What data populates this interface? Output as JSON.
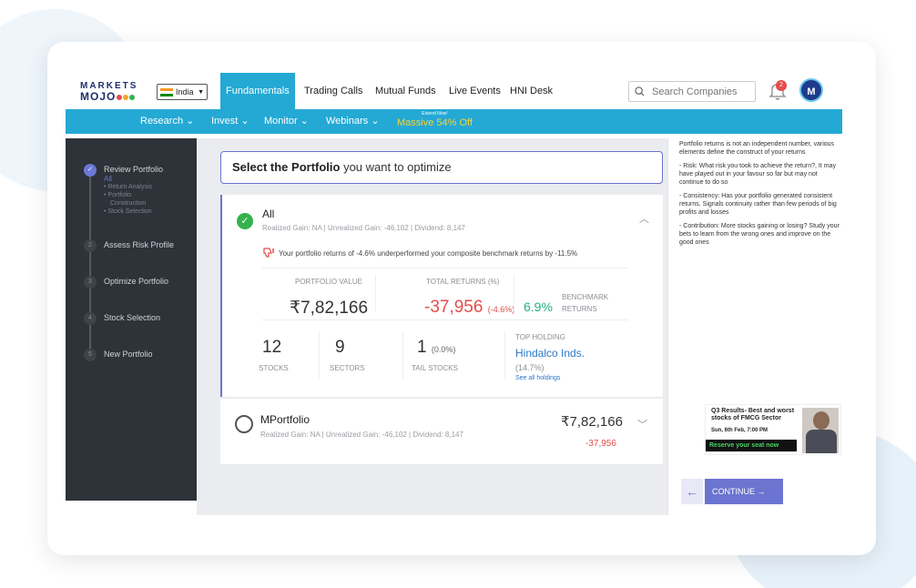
{
  "logo": {
    "line1": "MARKETS",
    "line2": "MOJO"
  },
  "country": {
    "label": "India"
  },
  "topnav": {
    "items": [
      "Fundamentals",
      "Trading Calls",
      "Mutual Funds",
      "Live Events",
      "HNI Desk"
    ],
    "active": "Fundamentals"
  },
  "search": {
    "placeholder": "Search Companies"
  },
  "notifications": {
    "count": "2"
  },
  "avatar": {
    "initial": "M"
  },
  "subnav": {
    "items": [
      "Research ⌄",
      "Invest ⌄",
      "Monitor ⌄",
      "Webinars ⌄"
    ],
    "promo_small": "Extend Now!",
    "promo_big": "Massive 54% Off"
  },
  "sidebar": {
    "steps": [
      {
        "num": "",
        "label": "Review Portfolio",
        "subs": [
          "All",
          "• Return Analysis",
          "• Portfolio",
          "  Construction",
          "• Stock Selection"
        ]
      },
      {
        "num": "2",
        "label": "Assess Risk Profile"
      },
      {
        "num": "3",
        "label": "Optimize Portfolio"
      },
      {
        "num": "4",
        "label": "Stock Selection"
      },
      {
        "num": "5",
        "label": "New Portfolio"
      }
    ]
  },
  "main": {
    "select_bold": "Select the Portfolio",
    "select_rest": " you want to optimize",
    "card_all": {
      "title": "All",
      "sub": "Realized Gain: NA  |  Unrealized Gain: -46,102  |  Dividend: 8,147",
      "warning": "Your portfolio returns of -4.6% underperformed your composite benchmark returns by -11.5%",
      "portfolio_value_label": "PORTFOLIO VALUE",
      "portfolio_value": "₹7,82,166",
      "total_returns_label": "TOTAL RETURNS (%)",
      "total_returns": "-37,956",
      "total_returns_pct": "(-4.6%)",
      "benchmark_value": "6.9%",
      "benchmark_label1": "BENCHMARK",
      "benchmark_label2": "RETURNS",
      "stocks_count": "12",
      "stocks_label": "STOCKS",
      "sectors_count": "9",
      "sectors_label": "SECTORS",
      "tail_count": "1",
      "tail_pct": "(0.0%)",
      "tail_label": "TAIL STOCKS",
      "top_holding_label": "TOP HOLDING",
      "top_holding": "Hindalco Inds.",
      "top_holding_pct": "(14.7%)",
      "see_all": "See all holdings"
    },
    "card_mportfolio": {
      "title": "MPortfolio",
      "sub": "Realized Gain: NA  |  Unrealized Gain: -46,102  |  Dividend: 8,147",
      "value": "₹7,82,166",
      "returns": "-37,956"
    }
  },
  "rightpanel": {
    "tips": [
      "Portfolio returns is not an independent number, various elements define the construct of your returns",
      "- Risk: What risk you took to achieve the return?, It may have played out in your favour so far but may not continue to do so",
      "- Consistency: Has your portfolio generated consistent returns. Signals continuity rather than few periods of big profits and losses",
      "- Contribution: More stocks gaining or losing? Study your bets to learn from the wrong ones and improve on the good ones"
    ],
    "ad_title": "Q3 Results- Best and worst stocks of FMCG Sector",
    "ad_date": "Sun, 6th Feb, 7:00 PM",
    "ad_button": "Reserve your seat now",
    "back": "←",
    "continue": "CONTINUE →"
  },
  "colors": {
    "brand": "#24a9d4",
    "accent": "#6b74d0",
    "negative": "#e64b4b",
    "positive": "#27b07e"
  }
}
